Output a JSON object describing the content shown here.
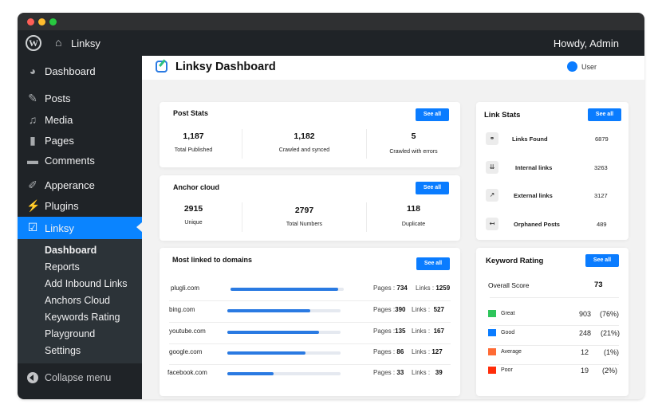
{
  "window": {
    "traffic_lights": [
      {
        "name": "close",
        "color": "#ff5f57"
      },
      {
        "name": "minimize",
        "color": "#febc2e"
      },
      {
        "name": "maximize",
        "color": "#28c840"
      }
    ]
  },
  "adminbar": {
    "wp_logo": "W",
    "home_icon": "⌂",
    "site_name": "Linksy",
    "greeting": "Howdy, Admin"
  },
  "sidebar": {
    "items": [
      {
        "label": "Dashboard",
        "icon": "dashboard-icon",
        "glyph": "◕"
      },
      {
        "label": "Posts",
        "icon": "pin-icon",
        "glyph": "✎"
      },
      {
        "label": "Media",
        "icon": "media-icon",
        "glyph": "♫"
      },
      {
        "label": "Pages",
        "icon": "pages-icon",
        "glyph": "▮"
      },
      {
        "label": "Comments",
        "icon": "comments-icon",
        "glyph": "▬"
      },
      {
        "label": "Apperance",
        "icon": "brush-icon",
        "glyph": "✐"
      },
      {
        "label": "Plugins",
        "icon": "plugin-icon",
        "glyph": "⚡"
      },
      {
        "label": "Linksy",
        "icon": "linksy-icon",
        "glyph": "☑"
      }
    ],
    "submenu": [
      "Dashboard",
      "Reports",
      "Add Inbound Links",
      "Anchors Cloud",
      "Keywords Rating",
      "Playground",
      "Settings"
    ],
    "collapse_label": "Collapse menu"
  },
  "header": {
    "title": "Linksy Dashboard",
    "user_label": "User"
  },
  "post_stats": {
    "title": "Post Stats",
    "button": "See all",
    "stats": [
      {
        "value": "1,187",
        "label": "Total Published"
      },
      {
        "value": "1,182",
        "label": "Crawled and synced"
      },
      {
        "value": "5",
        "label": "Crawled with errors"
      }
    ]
  },
  "anchor_cloud": {
    "title": "Anchor cloud",
    "button": "See all",
    "stats": [
      {
        "value": "2915",
        "label": "Unique"
      },
      {
        "value": "2797",
        "label": "Total Numbers"
      },
      {
        "value": "118",
        "label": "Duplicate"
      }
    ]
  },
  "domains": {
    "title": "Most linked to domains",
    "button": "See all",
    "pages_label": "Pages :",
    "links_label": "Links :",
    "rows": [
      {
        "domain": "plugli.com",
        "fill": 0.95,
        "pages": "734",
        "links": "1259"
      },
      {
        "domain": "bing.com",
        "fill": 0.73,
        "pages": "390",
        "links": "527"
      },
      {
        "domain": "youtube.com",
        "fill": 0.81,
        "pages": "135",
        "links": "167"
      },
      {
        "domain": "google.com",
        "fill": 0.69,
        "pages": "86",
        "links": "127"
      },
      {
        "domain": "facebook.com",
        "fill": 0.41,
        "pages": "33",
        "links": "39"
      }
    ]
  },
  "link_stats": {
    "title": "Link Stats",
    "button": "See all",
    "rows": [
      {
        "label": "Links Found",
        "value": "6879",
        "icon": "link-icon",
        "glyph": "⚭"
      },
      {
        "label": "Internal links",
        "value": "3263",
        "icon": "internal-link-icon",
        "glyph": "⇊"
      },
      {
        "label": "External links",
        "value": "3127",
        "icon": "external-link-icon",
        "glyph": "↗"
      },
      {
        "label": "Orphaned Posts",
        "value": "489",
        "icon": "orphan-icon",
        "glyph": "↤"
      }
    ]
  },
  "keyword_rating": {
    "title": "Keyword Rating",
    "button": "See all",
    "overall_label": "Overall Score",
    "overall_value": "73",
    "rows": [
      {
        "label": "Great",
        "count": "903",
        "pct": "(76%)",
        "color": "#2ec55b"
      },
      {
        "label": "Good",
        "count": "248",
        "pct": "(21%)",
        "color": "#0a7cff"
      },
      {
        "label": "Average",
        "count": "12",
        "pct": "(1%)",
        "color": "#ff6b35"
      },
      {
        "label": "Poor",
        "count": "19",
        "pct": "(2%)",
        "color": "#ff2d0a"
      }
    ]
  }
}
